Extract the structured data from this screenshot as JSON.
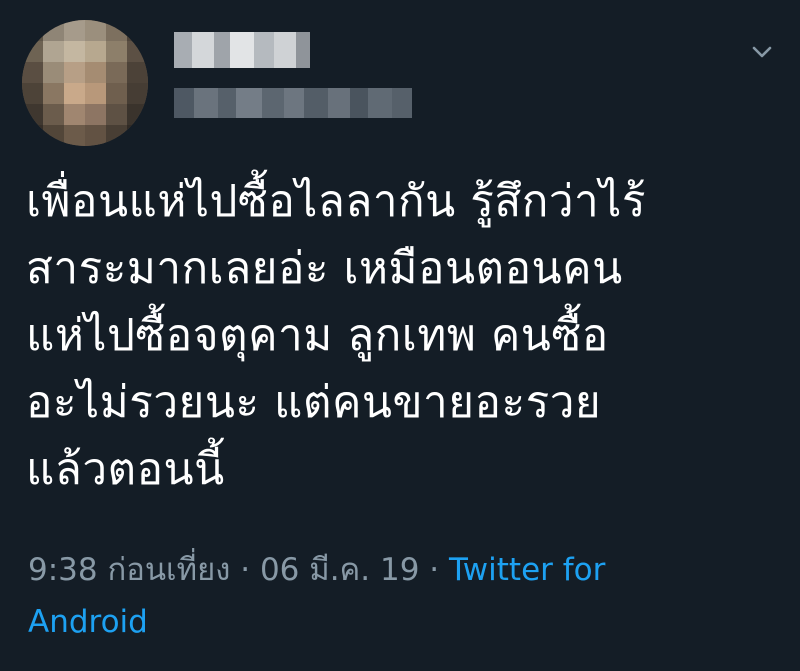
{
  "tweet": {
    "text_lines": [
      "เพื่อนแห่ไปซื้อไลลากัน รู้สึกว่าไร้",
      "สาระมากเลยอ่ะ เหมือนตอนคน",
      "แห่ไปซื้อจตุคาม ลูกเทพ คนซื้อ",
      "อะไม่รวยนะ แต่คนขายอะรวย",
      "แล้วตอนนี้"
    ],
    "time": "9:38 ก่อนเที่ยง",
    "separator": " · ",
    "date": "06 มี.ค. 19",
    "source_line1": "Twitter for",
    "source_line2": "Android"
  },
  "icons": {
    "caret": "chevron-down-icon"
  },
  "colors": {
    "background": "#141d26",
    "text": "#ffffff",
    "meta": "#8899a6",
    "link": "#1da1f2"
  }
}
